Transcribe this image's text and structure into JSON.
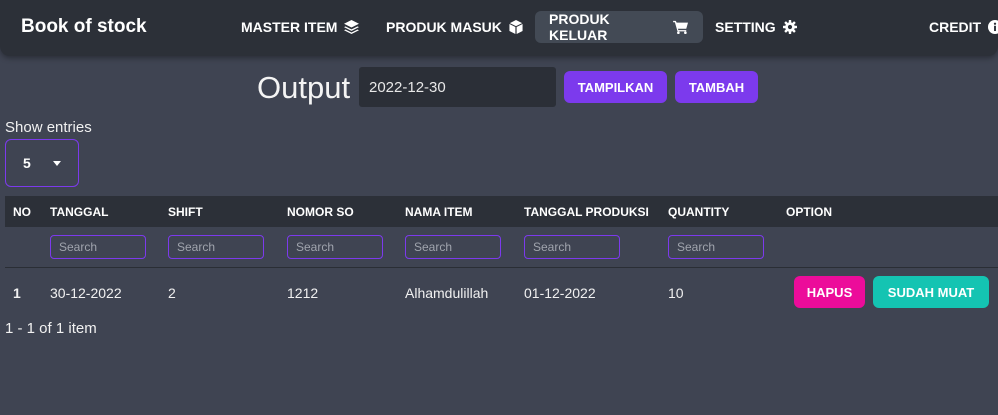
{
  "app": {
    "title": "Book of stock"
  },
  "nav": {
    "items": [
      {
        "label": "MASTER ITEM",
        "icon": "layers-icon"
      },
      {
        "label": "PRODUK MASUK",
        "icon": "box-icon"
      },
      {
        "label": "PRODUK KELUAR",
        "icon": "cart-icon",
        "active": true
      },
      {
        "label": "SETTING",
        "icon": "gear-icon"
      },
      {
        "label": "CREDIT",
        "icon": "info-icon"
      }
    ]
  },
  "toolbar": {
    "title": "Output",
    "date_value": "2022-12-30",
    "show_label": "TAMPILKAN",
    "add_label": "TAMBAH"
  },
  "entries": {
    "label": "Show entries",
    "selected": "5"
  },
  "table": {
    "columns": [
      "NO",
      "TANGGAL",
      "SHIFT",
      "NOMOR SO",
      "NAMA ITEM",
      "TANGGAL PRODUKSI",
      "QUANTITY",
      "OPTION"
    ],
    "search_placeholder": "Search",
    "rows": [
      {
        "no": "1",
        "tanggal": "30-12-2022",
        "shift": "2",
        "nomor_so": "1212",
        "nama_item": "Alhamdulillah",
        "tanggal_produksi": "01-12-2022",
        "quantity": "10",
        "delete_label": "HAPUS",
        "loaded_label": "SUDAH MUAT"
      }
    ]
  },
  "pagination": {
    "summary": "1 - 1 of 1 item"
  },
  "colors": {
    "background": "#3f4452",
    "navbar": "#2c3038",
    "accent": "#7c3aed",
    "danger": "#ec0c9a",
    "success": "#14c4b2"
  }
}
